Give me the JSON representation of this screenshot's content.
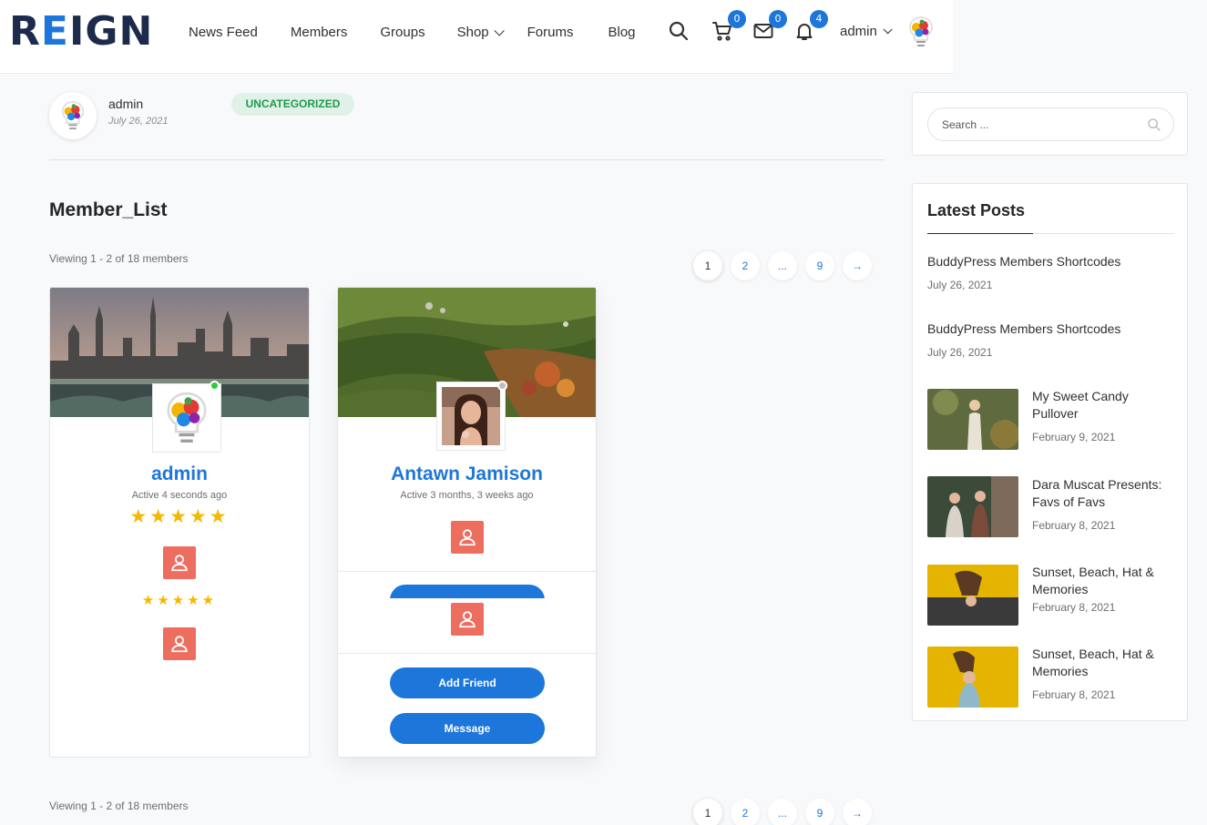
{
  "header": {
    "logo": {
      "part1": "R",
      "accent": "E",
      "part2": "IGN"
    },
    "nav": [
      "News Feed",
      "Members",
      "Groups",
      "Shop",
      "Forums",
      "Blog"
    ],
    "cart_count": "0",
    "messages_count": "0",
    "notifications_count": "4",
    "user": "admin"
  },
  "post": {
    "author": "admin",
    "date": "July 26, 2021",
    "category": "UNCATEGORIZED",
    "title": "Member_List"
  },
  "members": {
    "viewing_top": "Viewing 1 - 2 of 18 members",
    "viewing_bottom": "Viewing 1 - 2 of 18 members",
    "pagination": [
      "1",
      "2",
      "...",
      "9",
      "→"
    ],
    "list": [
      {
        "name": "admin",
        "active": "Active 4 seconds ago",
        "stars": "★★★★★",
        "stars2": "★★★★★",
        "status_color": "#2ecc40"
      },
      {
        "name": "Antawn Jamison",
        "active": "Active 3 months, 3 weeks ago",
        "add_friend": "Add Friend",
        "message": "Message",
        "status_color": "#bdbdbd"
      }
    ]
  },
  "sidebar": {
    "search_placeholder": "Search ...",
    "latest_title": "Latest Posts",
    "posts": [
      {
        "title": "BuddyPress Members Shortcodes",
        "date": "July 26, 2021"
      },
      {
        "title": "BuddyPress Members Shortcodes",
        "date": "July 26, 2021"
      },
      {
        "title": "My Sweet Candy Pullover",
        "date": "February 9, 2021"
      },
      {
        "title": "Dara Muscat Presents: Favs of Favs",
        "date": "February 8, 2021"
      },
      {
        "title": "Sunset, Beach, Hat & Memories",
        "date": "February 8, 2021"
      },
      {
        "title": "Sunset, Beach, Hat & Memories",
        "date": "February 8, 2021"
      }
    ]
  },
  "colors": {
    "primary": "#1d76da",
    "profile_button": "#ed6e5f",
    "star": "#f6b700",
    "category_bg": "#e0f2e7",
    "category_text": "#1f9a4e"
  }
}
